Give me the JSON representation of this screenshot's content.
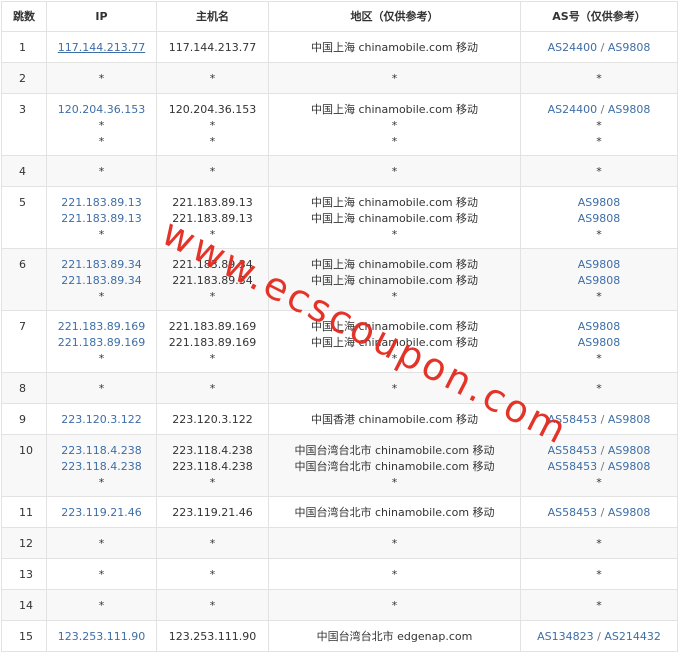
{
  "headers": [
    "跳数",
    "IP",
    "主机名",
    "地区（仅供参考）",
    "AS号（仅供参考）"
  ],
  "rows": [
    {
      "hop": "1",
      "ip": [
        "117.144.213.77"
      ],
      "host": [
        "117.144.213.77"
      ],
      "region": [
        "中国上海 chinamobile.com 移动"
      ],
      "as": [
        [
          "AS24400",
          "AS9808"
        ]
      ]
    },
    {
      "hop": "2",
      "ip": [
        "*"
      ],
      "host": [
        "*"
      ],
      "region": [
        "*"
      ],
      "as": [
        [
          "*"
        ]
      ]
    },
    {
      "hop": "3",
      "ip": [
        "120.204.36.153",
        "*",
        "*"
      ],
      "host": [
        "120.204.36.153",
        "*",
        "*"
      ],
      "region": [
        "中国上海 chinamobile.com 移动",
        "*",
        "*"
      ],
      "as": [
        [
          "AS24400",
          "AS9808"
        ],
        [
          "*"
        ],
        [
          "*"
        ]
      ]
    },
    {
      "hop": "4",
      "ip": [
        "*"
      ],
      "host": [
        "*"
      ],
      "region": [
        "*"
      ],
      "as": [
        [
          "*"
        ]
      ]
    },
    {
      "hop": "5",
      "ip": [
        "221.183.89.13",
        "221.183.89.13",
        "*"
      ],
      "host": [
        "221.183.89.13",
        "221.183.89.13",
        "*"
      ],
      "region": [
        "中国上海 chinamobile.com 移动",
        "中国上海 chinamobile.com 移动",
        "*"
      ],
      "as": [
        [
          "AS9808"
        ],
        [
          "AS9808"
        ],
        [
          "*"
        ]
      ]
    },
    {
      "hop": "6",
      "ip": [
        "221.183.89.34",
        "221.183.89.34",
        "*"
      ],
      "host": [
        "221.183.89.34",
        "221.183.89.34",
        "*"
      ],
      "region": [
        "中国上海 chinamobile.com 移动",
        "中国上海 chinamobile.com 移动",
        "*"
      ],
      "as": [
        [
          "AS9808"
        ],
        [
          "AS9808"
        ],
        [
          "*"
        ]
      ]
    },
    {
      "hop": "7",
      "ip": [
        "221.183.89.169",
        "221.183.89.169",
        "*"
      ],
      "host": [
        "221.183.89.169",
        "221.183.89.169",
        "*"
      ],
      "region": [
        "中国上海 chinamobile.com 移动",
        "中国上海 chinamobile.com 移动",
        "*"
      ],
      "as": [
        [
          "AS9808"
        ],
        [
          "AS9808"
        ],
        [
          "*"
        ]
      ]
    },
    {
      "hop": "8",
      "ip": [
        "*"
      ],
      "host": [
        "*"
      ],
      "region": [
        "*"
      ],
      "as": [
        [
          "*"
        ]
      ]
    },
    {
      "hop": "9",
      "ip": [
        "223.120.3.122"
      ],
      "host": [
        "223.120.3.122"
      ],
      "region": [
        "中国香港 chinamobile.com 移动"
      ],
      "as": [
        [
          "AS58453",
          "AS9808"
        ]
      ]
    },
    {
      "hop": "10",
      "ip": [
        "223.118.4.238",
        "223.118.4.238",
        "*"
      ],
      "host": [
        "223.118.4.238",
        "223.118.4.238",
        "*"
      ],
      "region": [
        "中国台湾台北市 chinamobile.com 移动",
        "中国台湾台北市 chinamobile.com 移动",
        "*"
      ],
      "as": [
        [
          "AS58453",
          "AS9808"
        ],
        [
          "AS58453",
          "AS9808"
        ],
        [
          "*"
        ]
      ]
    },
    {
      "hop": "11",
      "ip": [
        "223.119.21.46"
      ],
      "host": [
        "223.119.21.46"
      ],
      "region": [
        "中国台湾台北市 chinamobile.com 移动"
      ],
      "as": [
        [
          "AS58453",
          "AS9808"
        ]
      ]
    },
    {
      "hop": "12",
      "ip": [
        "*"
      ],
      "host": [
        "*"
      ],
      "region": [
        "*"
      ],
      "as": [
        [
          "*"
        ]
      ]
    },
    {
      "hop": "13",
      "ip": [
        "*"
      ],
      "host": [
        "*"
      ],
      "region": [
        "*"
      ],
      "as": [
        [
          "*"
        ]
      ]
    },
    {
      "hop": "14",
      "ip": [
        "*"
      ],
      "host": [
        "*"
      ],
      "region": [
        "*"
      ],
      "as": [
        [
          "*"
        ]
      ]
    },
    {
      "hop": "15",
      "ip": [
        "123.253.111.90"
      ],
      "host": [
        "123.253.111.90"
      ],
      "region": [
        "中国台湾台北市 edgenap.com"
      ],
      "as": [
        [
          "AS134823",
          "AS214432"
        ]
      ]
    }
  ],
  "as_separator": " / ",
  "watermark": "www.ecscoupon.com",
  "colors": {
    "link": "#3e6ea6",
    "watermark": "#e32a1f",
    "border": "#e2e2e2",
    "stripe": "#f8f8f8"
  }
}
